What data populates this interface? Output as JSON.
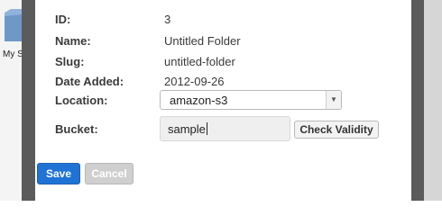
{
  "desktop": {
    "item_label": "My Sam"
  },
  "form": {
    "fields": {
      "id": {
        "label": "ID:",
        "value": "3"
      },
      "name": {
        "label": "Name:",
        "value": "Untitled Folder"
      },
      "slug": {
        "label": "Slug:",
        "value": "untitled-folder"
      },
      "date_added": {
        "label": "Date Added:",
        "value": "2012-09-26"
      },
      "location": {
        "label": "Location:",
        "selected": "amazon-s3"
      },
      "bucket": {
        "label": "Bucket:",
        "value": "sample"
      }
    },
    "check_validity_label": "Check Validity",
    "save_label": "Save",
    "cancel_label": "Cancel"
  },
  "colors": {
    "frame": "#5b5b5b",
    "save_button": "#1f73d4",
    "cancel_button_disabled": "#cfcfcf"
  }
}
